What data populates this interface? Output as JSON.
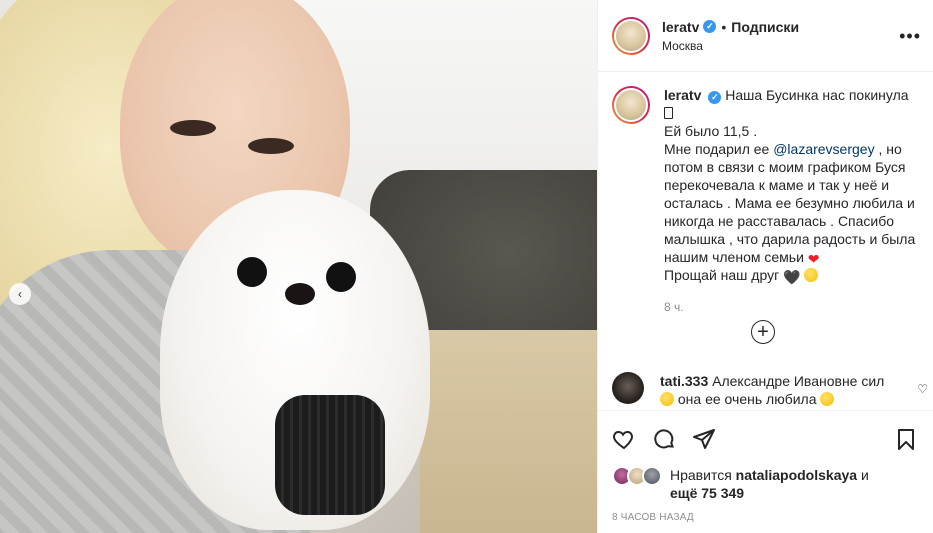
{
  "post": {
    "username": "leratv",
    "follow_label": "Подписки",
    "separator": "•",
    "location": "Москва",
    "more_label": "•••",
    "carousel_prev": "‹"
  },
  "caption": {
    "username": "leratv",
    "line1": "Наша Бусинка нас покинула",
    "line2": "Ей было 11,5 .",
    "line3_pre": "Мне подарил ее",
    "mention": "@lazarevsergey",
    "line3_post": ", но потом в связи с моим графиком Буся перекочевала к маме и так у неё и осталась . Мама ее безумно любила и никогда не расставалась . Спасибо малышка , что дарила радость и была нашим членом семьи",
    "line4": "Прощай наш друг",
    "heart": "❤",
    "black_heart": "🖤",
    "time": "8 ч.",
    "load_more": "+"
  },
  "comment": {
    "username": "tati.333",
    "text": "Александре Ивановне сил",
    "text2": "она ее очень любила",
    "like_icon": "♡"
  },
  "likes": {
    "prefix": "Нравится",
    "user": "nataliapodolskaya",
    "and": "и",
    "others": "ещё 75 349"
  },
  "timestamp": "8 ЧАСОВ НАЗАД",
  "colors": {
    "verified": "#3897f0",
    "mention": "#00376b",
    "muted": "#8e8e8e",
    "border": "#efefef"
  }
}
